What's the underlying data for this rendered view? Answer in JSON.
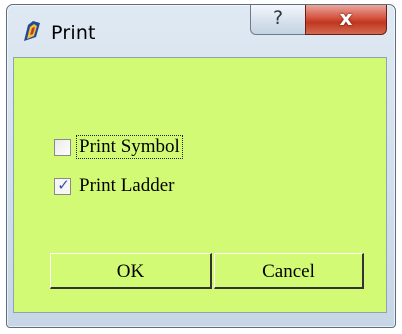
{
  "window": {
    "title": "Print",
    "help_glyph": "?",
    "close_glyph": "x"
  },
  "options": [
    {
      "label": "Print Symbol",
      "checked": false,
      "icon": "checkbox-unchecked"
    },
    {
      "label": "Print Ladder",
      "checked": true,
      "icon": "checkbox-checked",
      "mark": "✓"
    }
  ],
  "buttons": {
    "ok_label": "OK",
    "cancel_label": "Cancel"
  },
  "colors": {
    "client_background": "#d2fa75",
    "close_button": "#c0361f",
    "frame": "#c7d6e6"
  }
}
